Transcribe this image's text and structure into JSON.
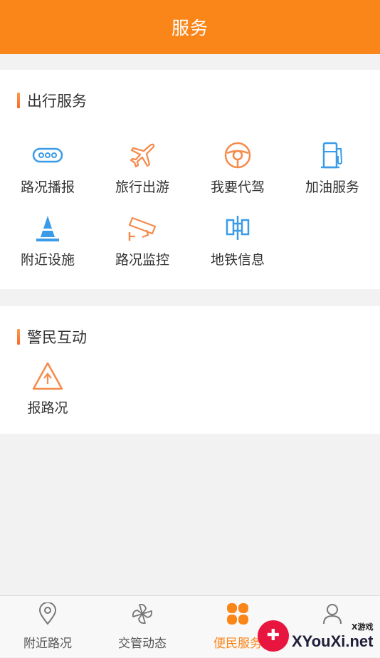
{
  "header": {
    "title": "服务"
  },
  "travel": {
    "title": "出行服务",
    "items": [
      {
        "label": "路况播报",
        "icon": "traffic-broadcast-icon"
      },
      {
        "label": "旅行出游",
        "icon": "airplane-icon"
      },
      {
        "label": "我要代驾",
        "icon": "steering-wheel-icon"
      },
      {
        "label": "加油服务",
        "icon": "gas-pump-icon"
      },
      {
        "label": "附近设施",
        "icon": "traffic-cone-icon"
      },
      {
        "label": "路况监控",
        "icon": "camera-icon"
      },
      {
        "label": "地铁信息",
        "icon": "metro-icon"
      }
    ]
  },
  "police": {
    "title": "警民互动",
    "items": [
      {
        "label": "报路况",
        "icon": "warning-triangle-icon"
      }
    ]
  },
  "tabbar": {
    "tabs": [
      {
        "label": "附近路况",
        "icon": "location-pin-icon",
        "active": false
      },
      {
        "label": "交管动态",
        "icon": "pinwheel-icon",
        "active": false
      },
      {
        "label": "便民服务",
        "icon": "grid-flower-icon",
        "active": true
      },
      {
        "label": "",
        "icon": "user-icon",
        "active": false
      }
    ]
  },
  "watermark": {
    "small": "X游戏",
    "text": "XYouXi.net"
  },
  "colors": {
    "accent": "#fa8519",
    "blue": "#3a9be8",
    "orange_icon": "#f58a4a"
  }
}
